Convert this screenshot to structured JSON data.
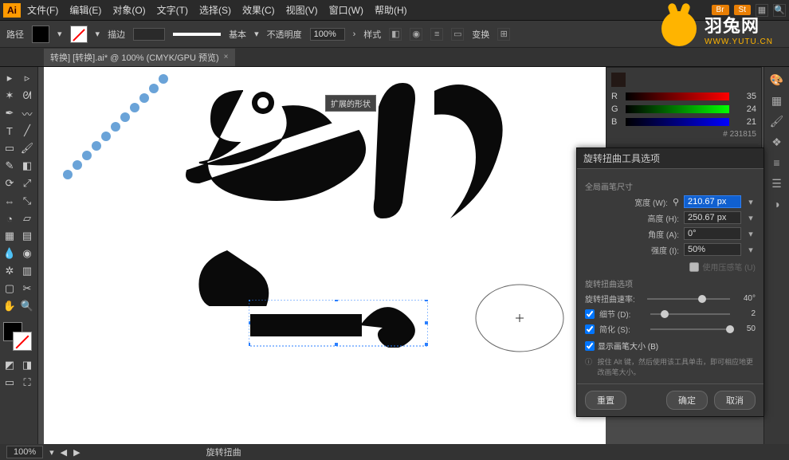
{
  "app": {
    "logo": "Ai"
  },
  "menu": {
    "file": "文件(F)",
    "edit": "编辑(E)",
    "object": "对象(O)",
    "type": "文字(T)",
    "select": "选择(S)",
    "effect": "效果(C)",
    "view": "视图(V)",
    "window": "窗口(W)",
    "help": "帮助(H)"
  },
  "titlebar_badges": {
    "br": "Br",
    "st": "St"
  },
  "control": {
    "path_label": "路径",
    "stroke_label": "描边",
    "stroke_value": "",
    "stroke_style": "基本",
    "opacity_label": "不透明度",
    "opacity_value": "100%",
    "style_label": "样式",
    "transform_btn": "变换"
  },
  "tab": {
    "name": "转换] [转换].ai* @ 100% (CMYK/GPU 预览)"
  },
  "tooltip": "扩展的形状",
  "color_panel": {
    "r": {
      "label": "R",
      "value": "35"
    },
    "g": {
      "label": "G",
      "value": "24"
    },
    "b": {
      "label": "B",
      "value": "21"
    },
    "hex": "231815"
  },
  "dialog": {
    "title": "旋转扭曲工具选项",
    "section_brush": "全局画笔尺寸",
    "width_label": "宽度 (W):",
    "width_value": "210.67 px",
    "height_label": "高度 (H):",
    "height_value": "250.67 px",
    "angle_label": "角度 (A):",
    "angle_value": "0°",
    "intensity_label": "强度 (I):",
    "intensity_value": "50%",
    "pressure_chk": "使用压感笔 (U)",
    "section_twirl": "旋转扭曲选项",
    "twirl_rate_label": "旋转扭曲速率:",
    "twirl_rate_value": "40°",
    "detail_label": "细节 (D):",
    "detail_value": "2",
    "simplify_label": "简化 (S):",
    "simplify_value": "50",
    "show_brush": "显示画笔大小 (B)",
    "info": "按住 Alt 键，然后使用该工具单击，即可相应地更改画笔大小。",
    "reset_btn": "重置",
    "ok_btn": "确定",
    "cancel_btn": "取消"
  },
  "statusbar": {
    "zoom": "100%",
    "tool": "旋转扭曲"
  },
  "watermark": {
    "name": "羽兔网",
    "url": "WWW.YUTU.CN"
  }
}
